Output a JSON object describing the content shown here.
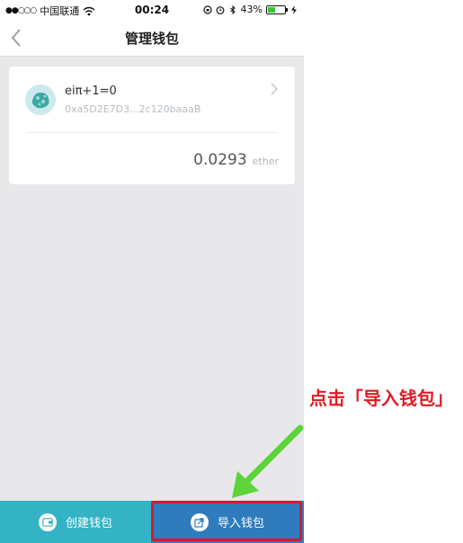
{
  "status_bar": {
    "signal": "●●○○○",
    "carrier": "中国联通",
    "time": "00:24",
    "battery_percent": "43%",
    "battery_level": 0.43
  },
  "nav": {
    "title": "管理钱包"
  },
  "wallet": {
    "name": "eiπ+1=0",
    "address": "0xa5D2E7D3...2c120baaaB",
    "balance": "0.0293",
    "unit": "ether"
  },
  "bottom": {
    "create_label": "创建钱包",
    "import_label": "导入钱包"
  },
  "annotation": {
    "text": "点击「导入钱包」"
  },
  "colors": {
    "create_bg": "#34b3c4",
    "import_bg": "#2e7bbd",
    "highlight": "#d9192b",
    "arrow": "#5cd43a",
    "annotation": "#e01b24"
  },
  "icons": {
    "back": "chevron-left-icon",
    "wallet_chevron": "chevron-right-icon",
    "create": "wallet-icon",
    "import": "import-icon"
  }
}
